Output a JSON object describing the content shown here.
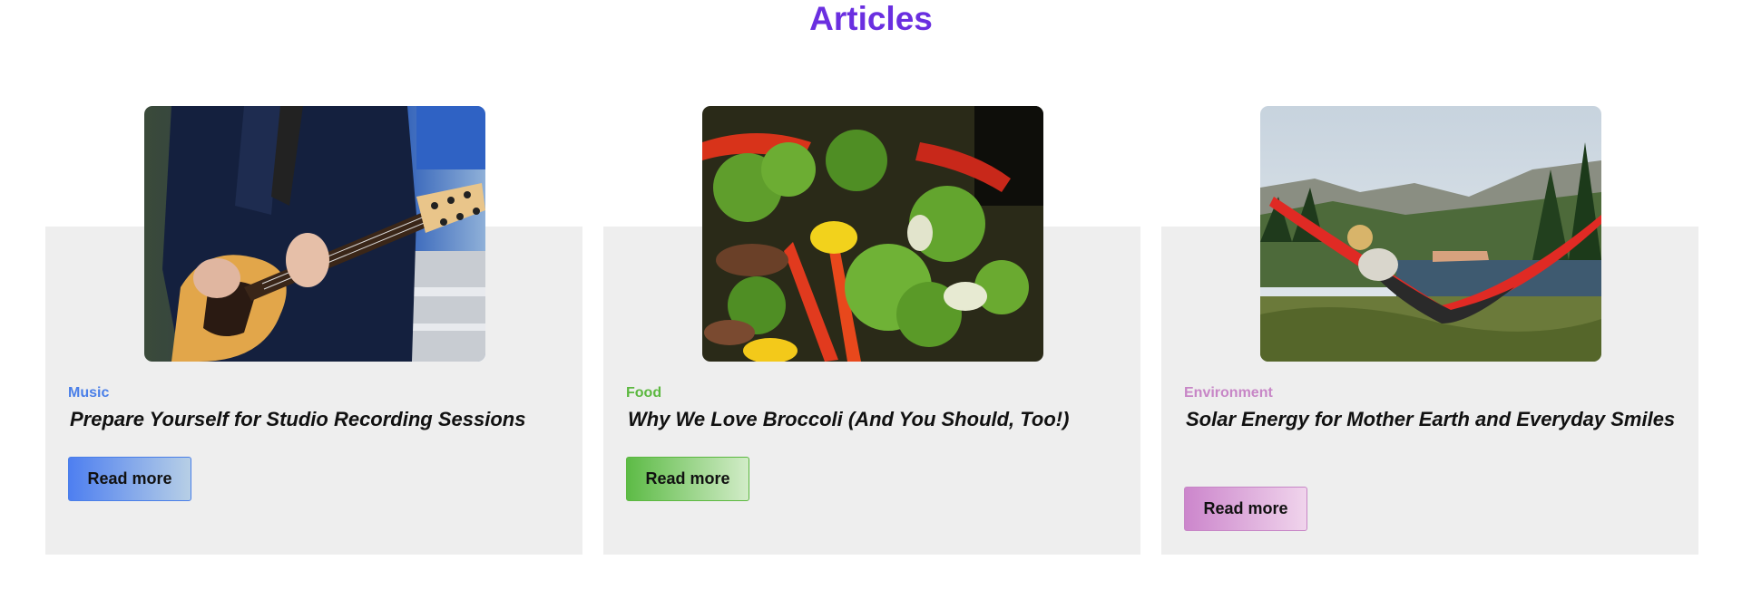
{
  "header": {
    "title": "Articles",
    "title_color": "#6a2fe0"
  },
  "articles": [
    {
      "category": "Music",
      "category_color": "#4a7fe8",
      "title": "Prepare Yourself for Studio Recording Sessions",
      "button_label": "Read more",
      "image": "guitar-player-photo",
      "accent": "#4a7fe8"
    },
    {
      "category": "Food",
      "category_color": "#5cb840",
      "title": "Why We Love Broccoli (And You Should, Too!)",
      "button_label": "Read more",
      "image": "broccoli-salad-photo",
      "accent": "#5cb840"
    },
    {
      "category": "Environment",
      "category_color": "#c786c6",
      "title": "Solar Energy for Mother Earth and Everyday Smiles",
      "button_label": "Read more",
      "image": "hammock-forest-photo",
      "accent": "#c786c6"
    }
  ]
}
